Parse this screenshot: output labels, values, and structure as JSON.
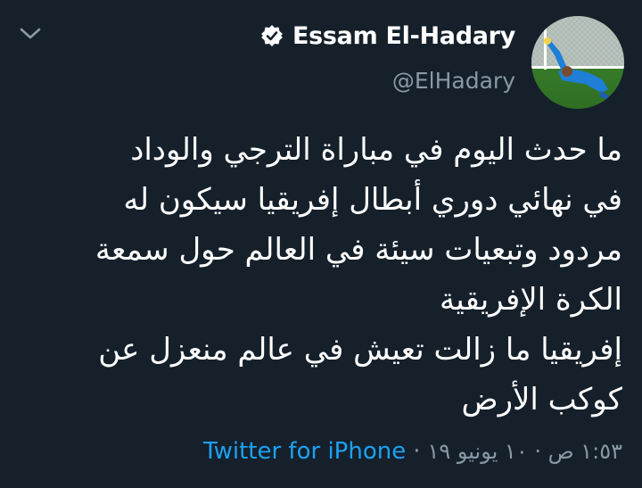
{
  "tweet": {
    "display_name": "Essam El-Hadary",
    "handle": "@ElHadary",
    "verified": true,
    "text_lines": [
      "ما حدث اليوم في مباراة الترجي والوداد",
      "في نهائي دوري أبطال إفريقيا سيكون له",
      "مردود وتبعيات سيئة في العالم حول سمعة",
      "الكرة الإفريقية",
      "إفريقيا ما زالت تعيش في عالم منعزل عن",
      "كوكب الأرض"
    ],
    "timestamp": "١:٥٣ ص · ١٠ يونيو ١٩",
    "separator": "·",
    "source": "Twitter for iPhone"
  },
  "icons": {
    "chevron": "chevron-down-icon",
    "verified": "verified-badge-icon",
    "avatar": "goalkeeper-diving-photo"
  },
  "colors": {
    "background": "#15202b",
    "text": "#ffffff",
    "secondary": "#8899a6",
    "link": "#1da1f2"
  }
}
